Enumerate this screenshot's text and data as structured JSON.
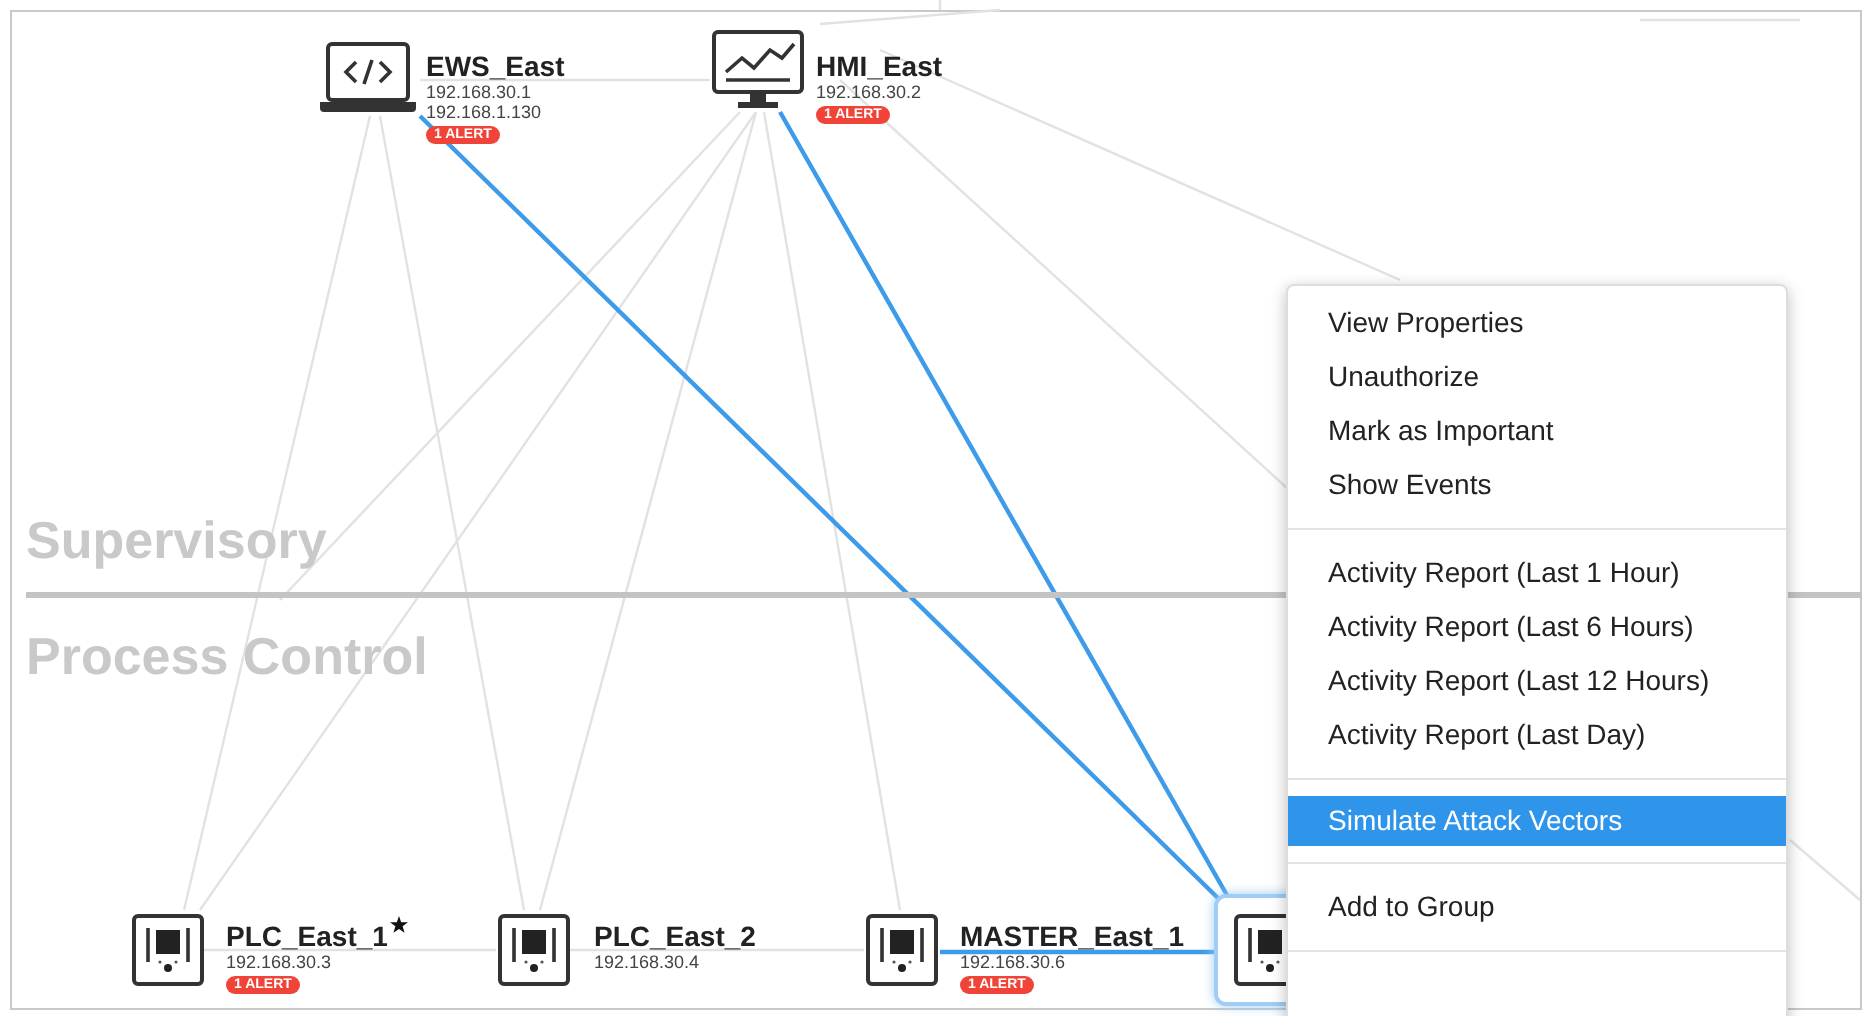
{
  "zones": [
    {
      "label": "Supervisory"
    },
    {
      "label": "Process Control"
    }
  ],
  "nodes": [
    {
      "kind": "laptop",
      "name": "EWS_East",
      "ips": [
        "192.168.30.1",
        "192.168.1.130"
      ],
      "alert": "1 ALERT",
      "starred": false,
      "selected": false
    },
    {
      "kind": "monitor",
      "name": "HMI_East",
      "ips": [
        "192.168.30.2"
      ],
      "alert": "1 ALERT",
      "starred": false,
      "selected": false
    },
    {
      "kind": "plc",
      "name": "PLC_East_1",
      "ips": [
        "192.168.30.3"
      ],
      "alert": "1 ALERT",
      "starred": true,
      "selected": false
    },
    {
      "kind": "plc",
      "name": "PLC_East_2",
      "ips": [
        "192.168.30.4"
      ],
      "starred": false,
      "selected": false
    },
    {
      "kind": "plc",
      "name": "MASTER_East_1",
      "ips": [
        "192.168.30.6"
      ],
      "alert": "1 ALERT",
      "starred": false,
      "selected": false
    },
    {
      "kind": "plc",
      "selected": true
    }
  ],
  "context_menu": {
    "groups": [
      [
        {
          "label": "View Properties",
          "selected": false
        },
        {
          "label": "Unauthorize",
          "selected": false
        },
        {
          "label": "Mark as Important",
          "selected": false
        },
        {
          "label": "Show Events",
          "selected": false
        }
      ],
      [
        {
          "label": "Activity Report (Last 1 Hour)",
          "selected": false
        },
        {
          "label": "Activity Report (Last 6 Hours)",
          "selected": false
        },
        {
          "label": "Activity Report (Last 12 Hours)",
          "selected": false
        },
        {
          "label": "Activity Report (Last Day)",
          "selected": false
        }
      ],
      [
        {
          "label": "Simulate Attack Vectors",
          "selected": true
        }
      ],
      [
        {
          "label": "Add to Group",
          "selected": false
        }
      ]
    ]
  }
}
